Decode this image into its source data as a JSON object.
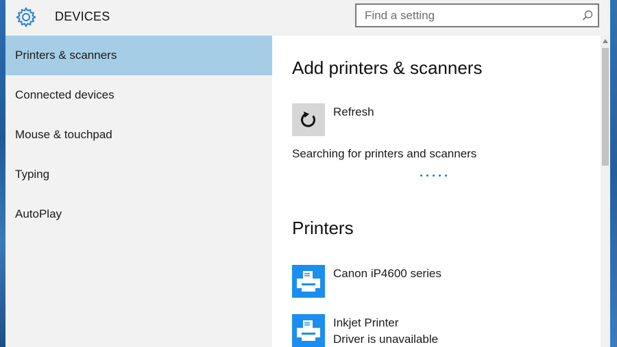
{
  "header": {
    "title": "DEVICES",
    "search_placeholder": "Find a setting",
    "search_value": ""
  },
  "sidebar": {
    "items": [
      {
        "label": "Printers & scanners",
        "active": true
      },
      {
        "label": "Connected devices",
        "active": false
      },
      {
        "label": "Mouse & touchpad",
        "active": false
      },
      {
        "label": "Typing",
        "active": false
      },
      {
        "label": "AutoPlay",
        "active": false
      }
    ]
  },
  "main": {
    "add_section_title": "Add printers & scanners",
    "refresh_label": "Refresh",
    "searching_text": "Searching for printers and scanners",
    "printers_section_title": "Printers",
    "printers": [
      {
        "name": "Canon iP4600 series",
        "status": ""
      },
      {
        "name": "Inkjet Printer",
        "status": "Driver is unavailable"
      }
    ]
  },
  "icons": {
    "settings": "gear-icon",
    "search": "search-icon",
    "refresh": "refresh-icon",
    "printer": "printer-icon"
  },
  "colors": {
    "accent": "#0a78d4",
    "selected_nav": "#a6cde6",
    "printer_tile": "#1b8ef0",
    "sidebar_bg": "#f2f2f2"
  }
}
